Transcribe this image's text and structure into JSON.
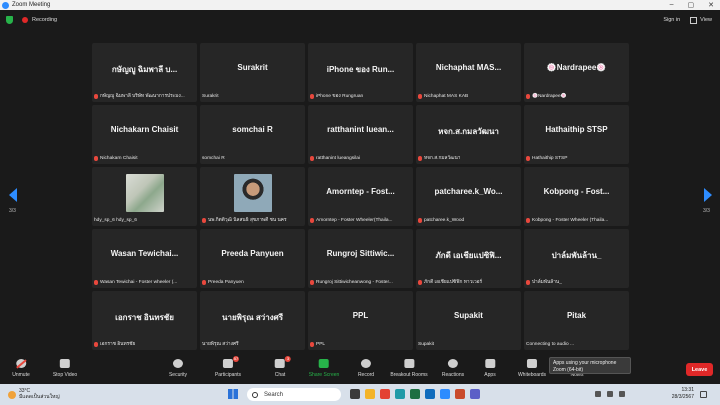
{
  "window": {
    "title": "Zoom Meeting",
    "controls": [
      "–",
      "▢",
      "✕"
    ]
  },
  "topbar": {
    "recording_label": "Recording",
    "sign_in_label": "Sign in",
    "view_label": "View"
  },
  "participants": [
    {
      "display": "กษัญญู ฉิมพาลี บ...",
      "label": "กษัญญู ฉิมพาลี บริษัท พัฒนาการประมง...",
      "muted": true,
      "photo": null
    },
    {
      "display": "Surakrit",
      "label": "Surakrit",
      "muted": false,
      "photo": null
    },
    {
      "display": "iPhone ของ Run...",
      "label": "iPhone ของ Rungruan",
      "muted": true,
      "photo": null
    },
    {
      "display": "Nichaphat  MAS...",
      "label": "Nichaphat MAS KAB",
      "muted": true,
      "photo": null
    },
    {
      "display": "🍥Nardrapee🍥",
      "label": "🍥Nardrapee🍥",
      "muted": true,
      "photo": null
    },
    {
      "display": "Nichakarn Chaisit",
      "label": "Nichakarn Chaisit",
      "muted": true,
      "photo": null
    },
    {
      "display": "somchai R",
      "label": "somchai R",
      "muted": false,
      "photo": null
    },
    {
      "display": "ratthanint  luean...",
      "label": "ratthanint lueangsilai",
      "muted": true,
      "photo": null
    },
    {
      "display": "หจก.ส.กมลวัฒนา",
      "label": "หจก.ส.กมลวัฒนา",
      "muted": true,
      "photo": null
    },
    {
      "display": "Hathaithip STSP",
      "label": "Hathaithip STSP",
      "muted": true,
      "photo": null
    },
    {
      "display": "",
      "label": "hdy_sp_6 hdy_sp_6",
      "muted": false,
      "photo": "map"
    },
    {
      "display": "",
      "label": "นพ.กิตติวุฒิ นิลสนธิ สุขภาพดี ชน นคร",
      "muted": true,
      "photo": "face"
    },
    {
      "display": "Amorntep - Fost...",
      "label": "Amorntep - Foster Wheeler(Thaila...",
      "muted": true,
      "photo": null
    },
    {
      "display": "patcharee.k_Wo...",
      "label": "patcharee.k_Wood",
      "muted": true,
      "photo": null
    },
    {
      "display": "Kobpong - Fost...",
      "label": "Kobpong - Foster Wheeler (Thaila...",
      "muted": true,
      "photo": null
    },
    {
      "display": "Wasan  Tewichai...",
      "label": "Wasan Tewichai - Foster wheeler (...",
      "muted": true,
      "photo": null
    },
    {
      "display": "Preeda  Panyuen",
      "label": "Preeda  Panyuen",
      "muted": true,
      "photo": null
    },
    {
      "display": "Rungroj  Sittiwic...",
      "label": "Rungroj Sittiwicheanwong - Foster...",
      "muted": true,
      "photo": null
    },
    {
      "display": "ภักดี เอเชียแปซิฟิ...",
      "label": "ภักดี เอเชียแปซิฟิก ทาวเวอร์",
      "muted": true,
      "photo": null
    },
    {
      "display": "ปาล์มพันล้าน_",
      "label": "ปาล์มพันล้าน_",
      "muted": true,
      "photo": null
    },
    {
      "display": "เอกราช อินทรชัย",
      "label": "เอกราช อินทรชัย",
      "muted": true,
      "photo": null
    },
    {
      "display": "นายพิรุณ สว่างศรี",
      "label": "นายพิรุณ สว่างศรี",
      "muted": false,
      "photo": null
    },
    {
      "display": "PPL",
      "label": "PPL",
      "muted": true,
      "photo": null
    },
    {
      "display": "Supakit",
      "label": "Supakit",
      "muted": false,
      "photo": null
    },
    {
      "display": "Pitak",
      "label": "Connecting to audio ...",
      "muted": false,
      "photo": null
    }
  ],
  "pagination": {
    "left": "3/3",
    "right": "3/3"
  },
  "toolbar": {
    "unmute": "Unmute",
    "stop_video": "Stop Video",
    "security": "Security",
    "participants": "Participants",
    "participants_count": "57",
    "chat": "Chat",
    "chat_badge": "3",
    "share_screen": "Share Screen",
    "record": "Record",
    "breakout": "Breakout Rooms",
    "reactions": "Reactions",
    "apps": "Apps",
    "whiteboards": "Whiteboards",
    "notes": "Notes",
    "leave": "Leave"
  },
  "tooltip": {
    "line1": "Apps using your microphone",
    "line2": "Zoom (64-bit)"
  },
  "taskbar": {
    "temp": "33°C",
    "weather_desc": "มีแดดเป็นส่วนใหญ่",
    "search_placeholder": "Search",
    "time": "13:31",
    "date": "28/3/2567"
  },
  "colors": {
    "accent": "#2d8cff",
    "leave": "#e02828",
    "share": "#27b34a",
    "muted_icon": "#e8483d"
  }
}
